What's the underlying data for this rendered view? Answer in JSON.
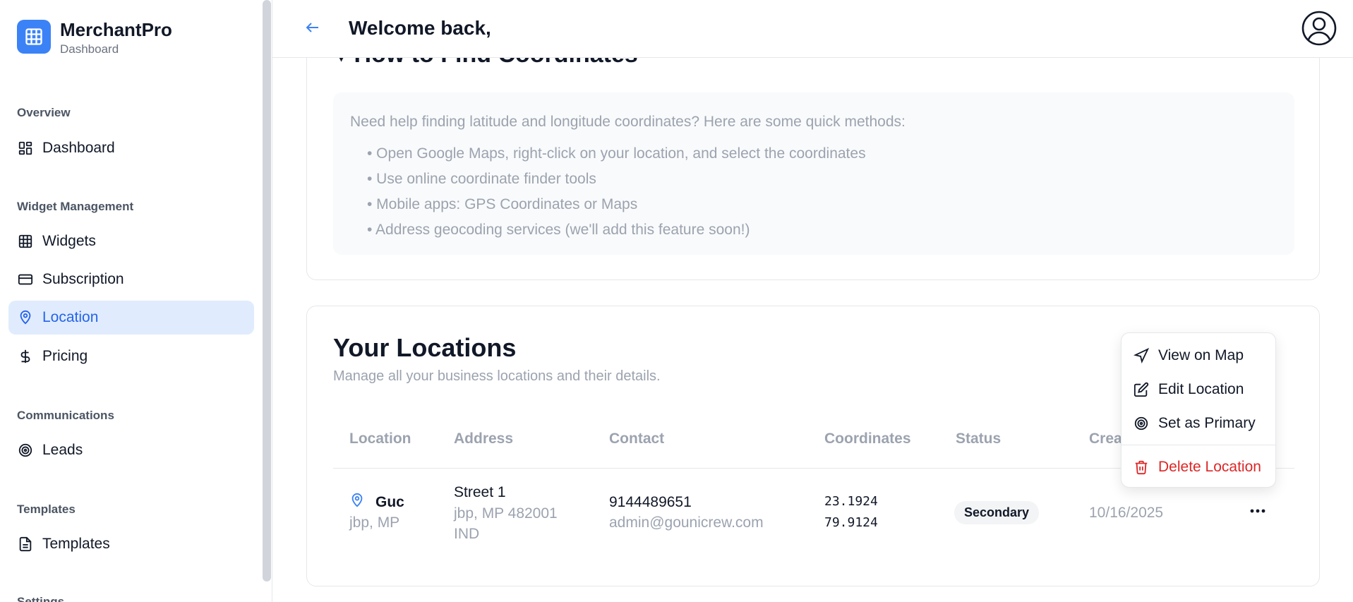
{
  "brand": {
    "name": "MerchantPro",
    "subtitle": "Dashboard"
  },
  "sidebar": {
    "sections": [
      {
        "label": "Overview"
      },
      {
        "label": "Widget Management"
      },
      {
        "label": "Communications"
      },
      {
        "label": "Templates"
      },
      {
        "label": "Settings"
      }
    ],
    "items": [
      {
        "label": "Dashboard",
        "icon": "dashboard-icon"
      },
      {
        "label": "Widgets",
        "icon": "grid-icon"
      },
      {
        "label": "Subscription",
        "icon": "credit-card-icon"
      },
      {
        "label": "Location",
        "icon": "map-pin-icon",
        "active": true
      },
      {
        "label": "Pricing",
        "icon": "dollar-icon"
      },
      {
        "label": "Leads",
        "icon": "target-icon"
      },
      {
        "label": "Templates",
        "icon": "document-icon"
      }
    ]
  },
  "header": {
    "welcome": "Welcome back,"
  },
  "help": {
    "title": "How to Find Coordinates",
    "intro": "Need help finding latitude and longitude coordinates? Here are some quick methods:",
    "items": [
      "• Open Google Maps, right-click on your location, and select the coordinates",
      "• Use online coordinate finder tools",
      "• Mobile apps: GPS Coordinates or Maps",
      "• Address geocoding services (we'll add this feature soon!)"
    ]
  },
  "locations": {
    "title": "Your Locations",
    "subtitle": "Manage all your business locations and their details.",
    "columns": [
      "Location",
      "Address",
      "Contact",
      "Coordinates",
      "Status",
      "Created"
    ],
    "rows": [
      {
        "name": "Guc",
        "city": "jbp, MP",
        "street": "Street 1",
        "address_line2": "jbp, MP 482001",
        "country": "IND",
        "phone": "9144489651",
        "email": "admin@gounicrew.com",
        "lat": "23.1924",
        "lng": "79.9124",
        "status": "Secondary",
        "created": "10/16/2025"
      }
    ]
  },
  "row_menu": {
    "items": [
      {
        "label": "View on Map",
        "icon": "navigation-icon"
      },
      {
        "label": "Edit Location",
        "icon": "edit-icon"
      },
      {
        "label": "Set as Primary",
        "icon": "target-icon"
      },
      {
        "label": "Delete Location",
        "icon": "trash-icon"
      }
    ]
  },
  "colors": {
    "accent": "#3b82f6",
    "active_bg": "#e0ecfd",
    "danger": "#dc2626"
  }
}
